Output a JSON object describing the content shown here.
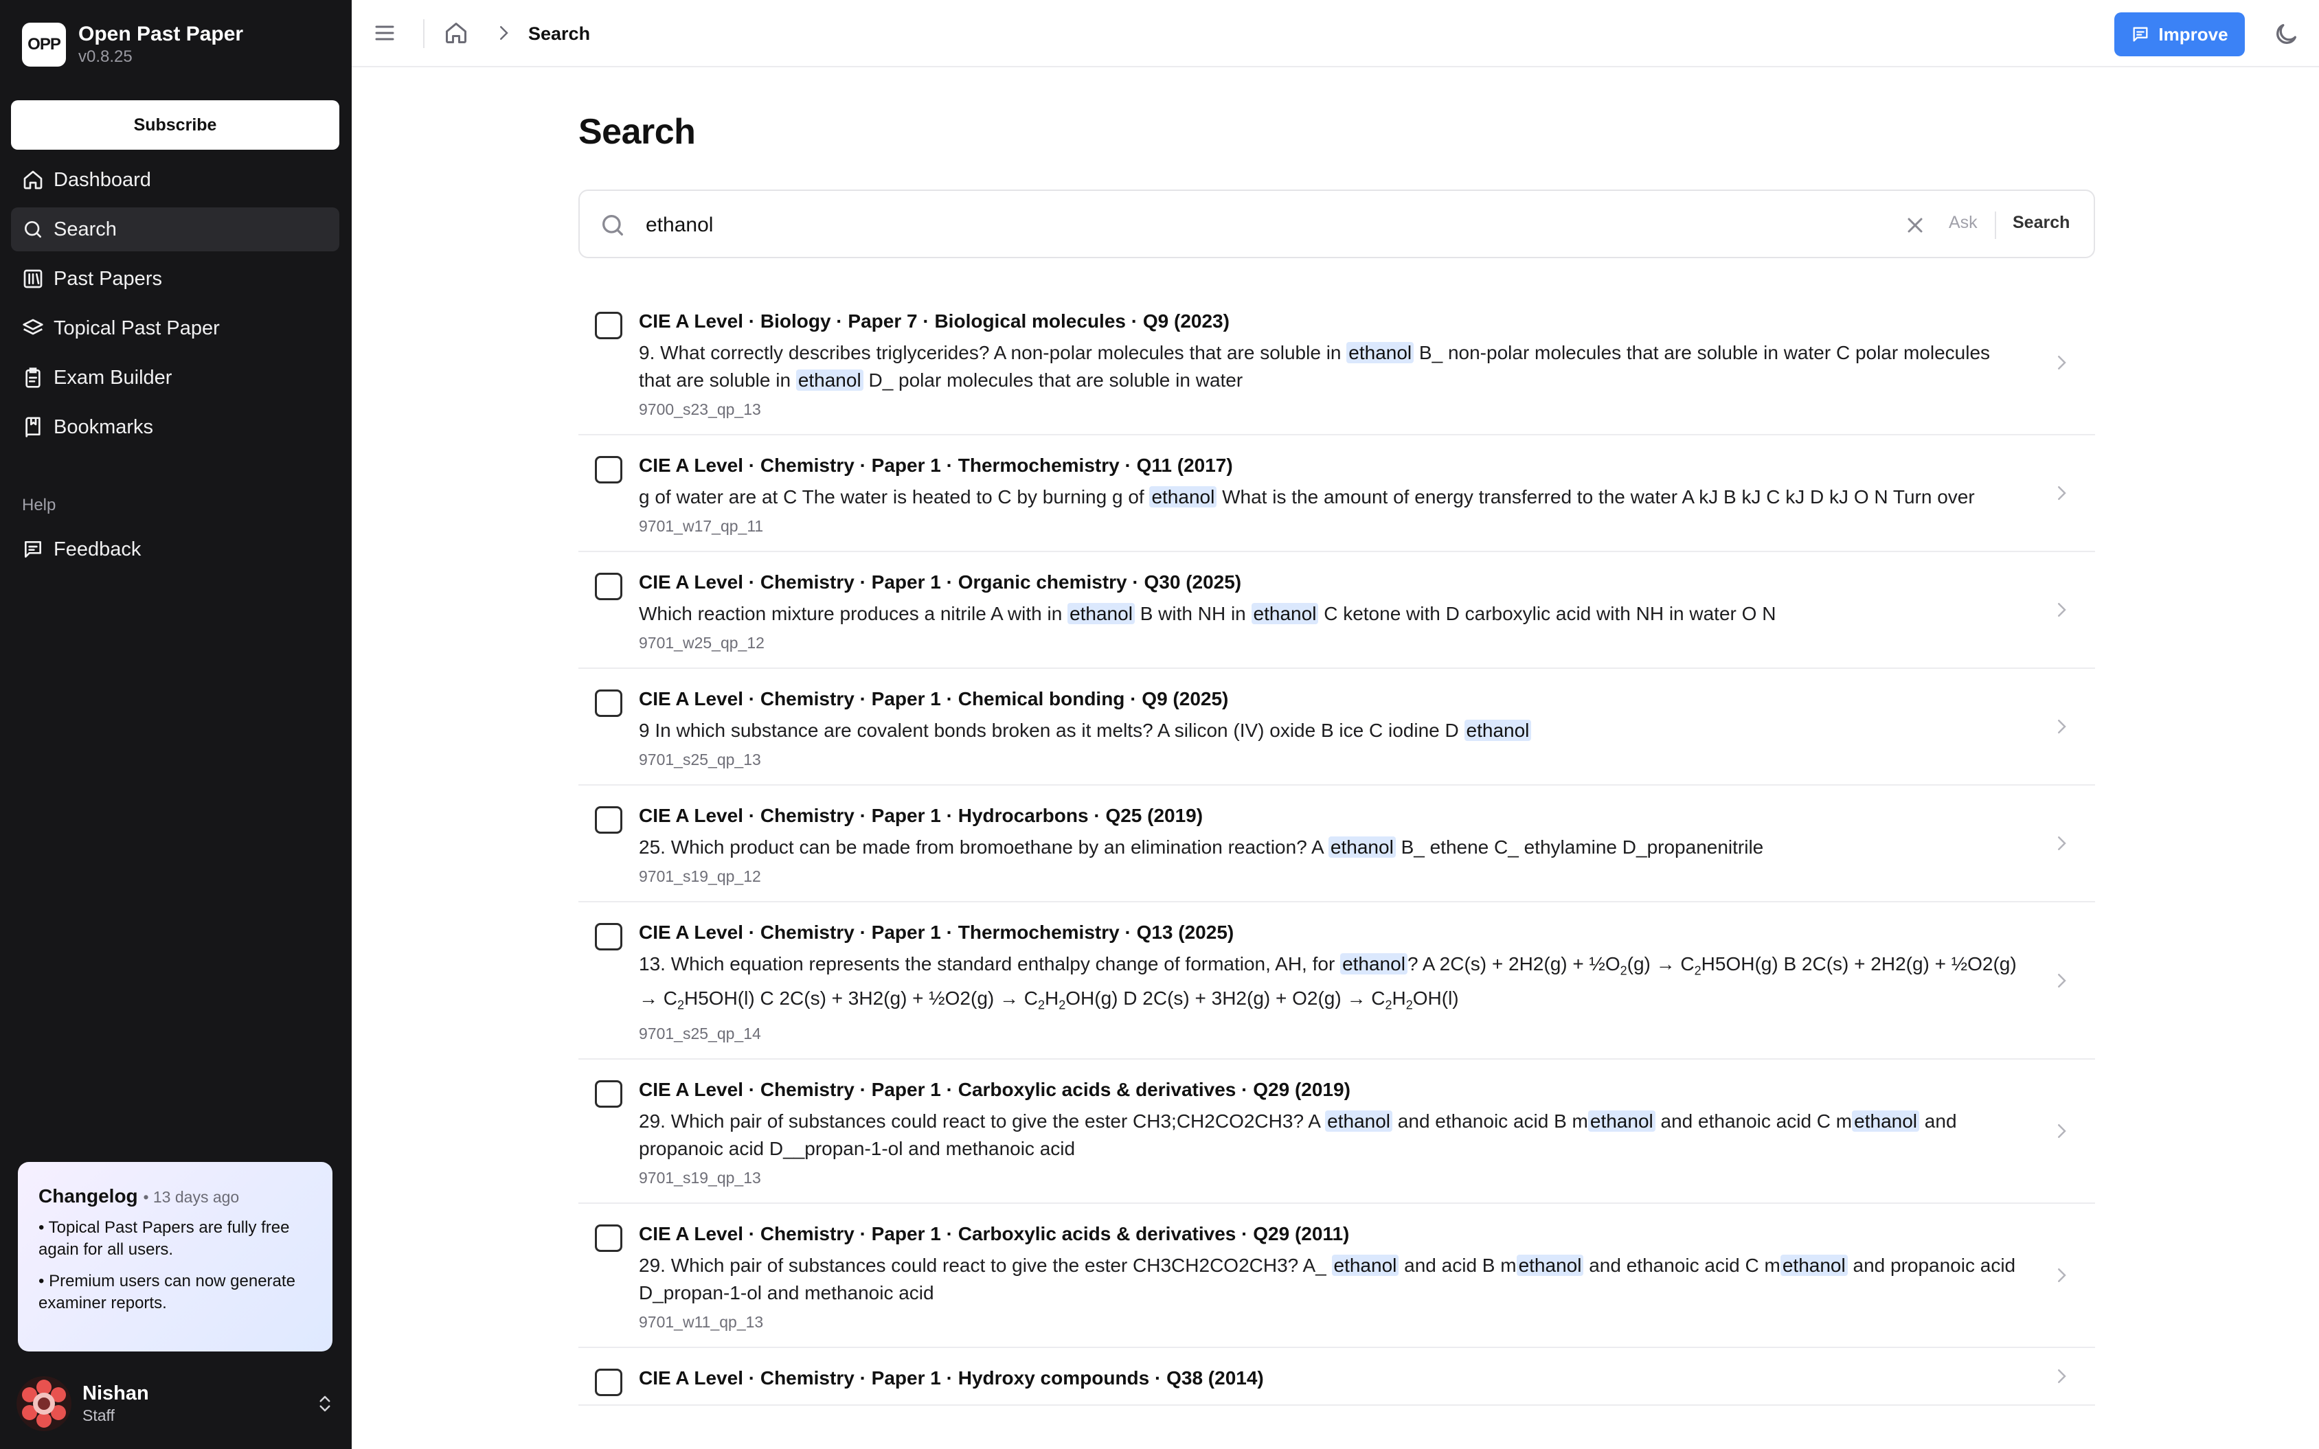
{
  "app": {
    "logo": "OPP",
    "name": "Open Past Paper",
    "version": "v0.8.25"
  },
  "sidebar": {
    "subscribe_label": "Subscribe",
    "nav": [
      {
        "label": "Dashboard",
        "icon": "home-icon"
      },
      {
        "label": "Search",
        "icon": "search-icon",
        "active": true
      },
      {
        "label": "Past Papers",
        "icon": "library-icon"
      },
      {
        "label": "Topical Past Paper",
        "icon": "layers-icon"
      },
      {
        "label": "Exam Builder",
        "icon": "clipboard-icon"
      },
      {
        "label": "Bookmarks",
        "icon": "book-icon"
      }
    ],
    "help_label": "Help",
    "help_nav": [
      {
        "label": "Feedback",
        "icon": "message-icon"
      }
    ]
  },
  "changelog": {
    "title": "Changelog",
    "ago": "• 13 days ago",
    "items": [
      "• Topical Past Papers are fully free again for all users.",
      "• Premium users can now generate examiner reports."
    ]
  },
  "user": {
    "name": "Nishan",
    "role": "Staff"
  },
  "topbar": {
    "breadcrumb_current": "Search",
    "improve_label": "Improve"
  },
  "page": {
    "title": "Search"
  },
  "search": {
    "value": "ethanol",
    "ask_label": "Ask",
    "search_label": "Search"
  },
  "colors": {
    "sidebar_bg": "#161618",
    "accent": "#3b82f6",
    "highlight": "#dbe8fd"
  },
  "results": [
    {
      "title": "CIE A Level · Biology · Paper 7 · Biological molecules · Q9 (2023)",
      "snippet": "9. What correctly describes triglycerides? A non-polar molecules that are soluble in [[ethanol]] B_ non-polar molecules that are soluble in water C polar molecules that are soluble in [[ethanol]] D_ polar molecules that are soluble in water",
      "code": "9700_s23_qp_13"
    },
    {
      "title": "CIE A Level · Chemistry · Paper 1 · Thermochemistry · Q11 (2017)",
      "snippet": "g of water are at C The water is heated to C by burning g of [[ethanol]] What is the amount of energy transferred to the water A kJ B kJ C kJ D kJ O N Turn over",
      "code": "9701_w17_qp_11"
    },
    {
      "title": "CIE A Level · Chemistry · Paper 1 · Organic chemistry · Q30 (2025)",
      "snippet": "Which reaction mixture produces a nitrile A with in [[ethanol]] B with NH in [[ethanol]] C ketone with D carboxylic acid with NH in water O N",
      "code": "9701_w25_qp_12"
    },
    {
      "title": "CIE A Level · Chemistry · Paper 1 · Chemical bonding · Q9 (2025)",
      "snippet": "9 In which substance are covalent bonds broken as it melts? A silicon (IV) oxide B ice C iodine D [[ethanol]]",
      "code": "9701_s25_qp_13"
    },
    {
      "title": "CIE A Level · Chemistry · Paper 1 · Hydrocarbons · Q25 (2019)",
      "snippet": "25. Which product can be made from bromoethane by an elimination reaction? A [[ethanol]] B_ ethene C_ ethylamine D_propanenitrile",
      "code": "9701_s19_qp_12"
    },
    {
      "title": "CIE A Level · Chemistry · Paper 1 · Thermochemistry · Q13 (2025)",
      "snippet": "13. Which equation represents the standard enthalpy change of formation, AH, for [[ethanol]]? A 2C(s) + 2H2(g) + ½O{2}(g) → C{2}H5OH(g) B 2C(s) + 2H2(g) + ½O2(g) → C{2}H5OH(l) C 2C(s) + 3H2(g) + ½O2(g) → C{2}H{2}OH(g) D 2C(s) + 3H2(g) + O2(g) → C{2}H{2}OH(l)",
      "code": "9701_s25_qp_14"
    },
    {
      "title": "CIE A Level · Chemistry · Paper 1 · Carboxylic acids & derivatives · Q29 (2019)",
      "snippet": "29. Which pair of substances could react to give the ester CH3;CH2CO2CH3? A [[ethanol]] and ethanoic acid B m[[ethanol]] and ethanoic acid C m[[ethanol]] and propanoic acid D__propan-1-ol and methanoic acid",
      "code": "9701_s19_qp_13"
    },
    {
      "title": "CIE A Level · Chemistry · Paper 1 · Carboxylic acids & derivatives · Q29 (2011)",
      "snippet": "29. Which pair of substances could react to give the ester CH3CH2CO2CH3? A_ [[ethanol]] and acid B m[[ethanol]] and ethanoic acid C m[[ethanol]] and propanoic acid D_propan-1-ol and methanoic acid",
      "code": "9701_w11_qp_13"
    },
    {
      "title": "CIE A Level · Chemistry · Paper 1 · Hydroxy compounds · Q38 (2014)",
      "snippet": "",
      "code": ""
    }
  ]
}
